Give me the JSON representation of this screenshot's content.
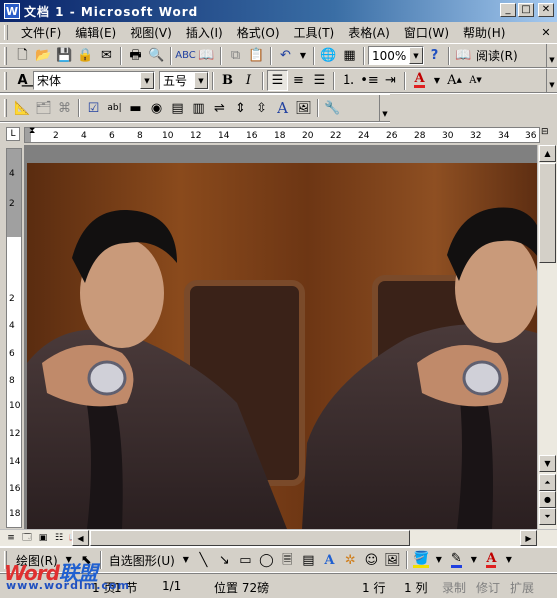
{
  "window": {
    "title": "文档 1 - Microsoft Word",
    "app_icon": "W"
  },
  "menubar": {
    "items": [
      "文件(F)",
      "编辑(E)",
      "视图(V)",
      "插入(I)",
      "格式(O)",
      "工具(T)",
      "表格(A)",
      "窗口(W)",
      "帮助(H)"
    ]
  },
  "standard_toolbar": {
    "zoom": "100%",
    "read_label": "阅读(R)"
  },
  "format_toolbar": {
    "font": "宋体",
    "size": "五号",
    "bold": "B",
    "italic": "I",
    "font_color_glyph": "A",
    "grow_font": "A",
    "shrink_font": "A"
  },
  "ruler": {
    "h_ticks": [
      "2",
      "2",
      "4",
      "6",
      "8",
      "10",
      "12",
      "14",
      "16",
      "18",
      "20",
      "22",
      "24",
      "26",
      "28",
      "30",
      "32",
      "34",
      "36"
    ],
    "v_ticks": [
      "4",
      "2",
      "2",
      "4",
      "6",
      "8",
      "10",
      "12",
      "14",
      "16",
      "18"
    ]
  },
  "drawbar": {
    "draw_label": "绘图(R)",
    "autoshape_label": "自选图形(U)"
  },
  "status": {
    "page": "1 页",
    "section": "1 节",
    "page_of": "1/1",
    "position": "位置 72磅",
    "line": "1 行",
    "col": "1 列",
    "rec": "录制",
    "trk": "修订",
    "ext": "扩展"
  },
  "watermark": {
    "brand_red": "Word",
    "brand_blue": "联盟",
    "url": "www.wordlm.com"
  },
  "colors": {
    "title_start": "#0a246a",
    "title_end": "#a6caf0",
    "chrome": "#d4d0c8"
  }
}
